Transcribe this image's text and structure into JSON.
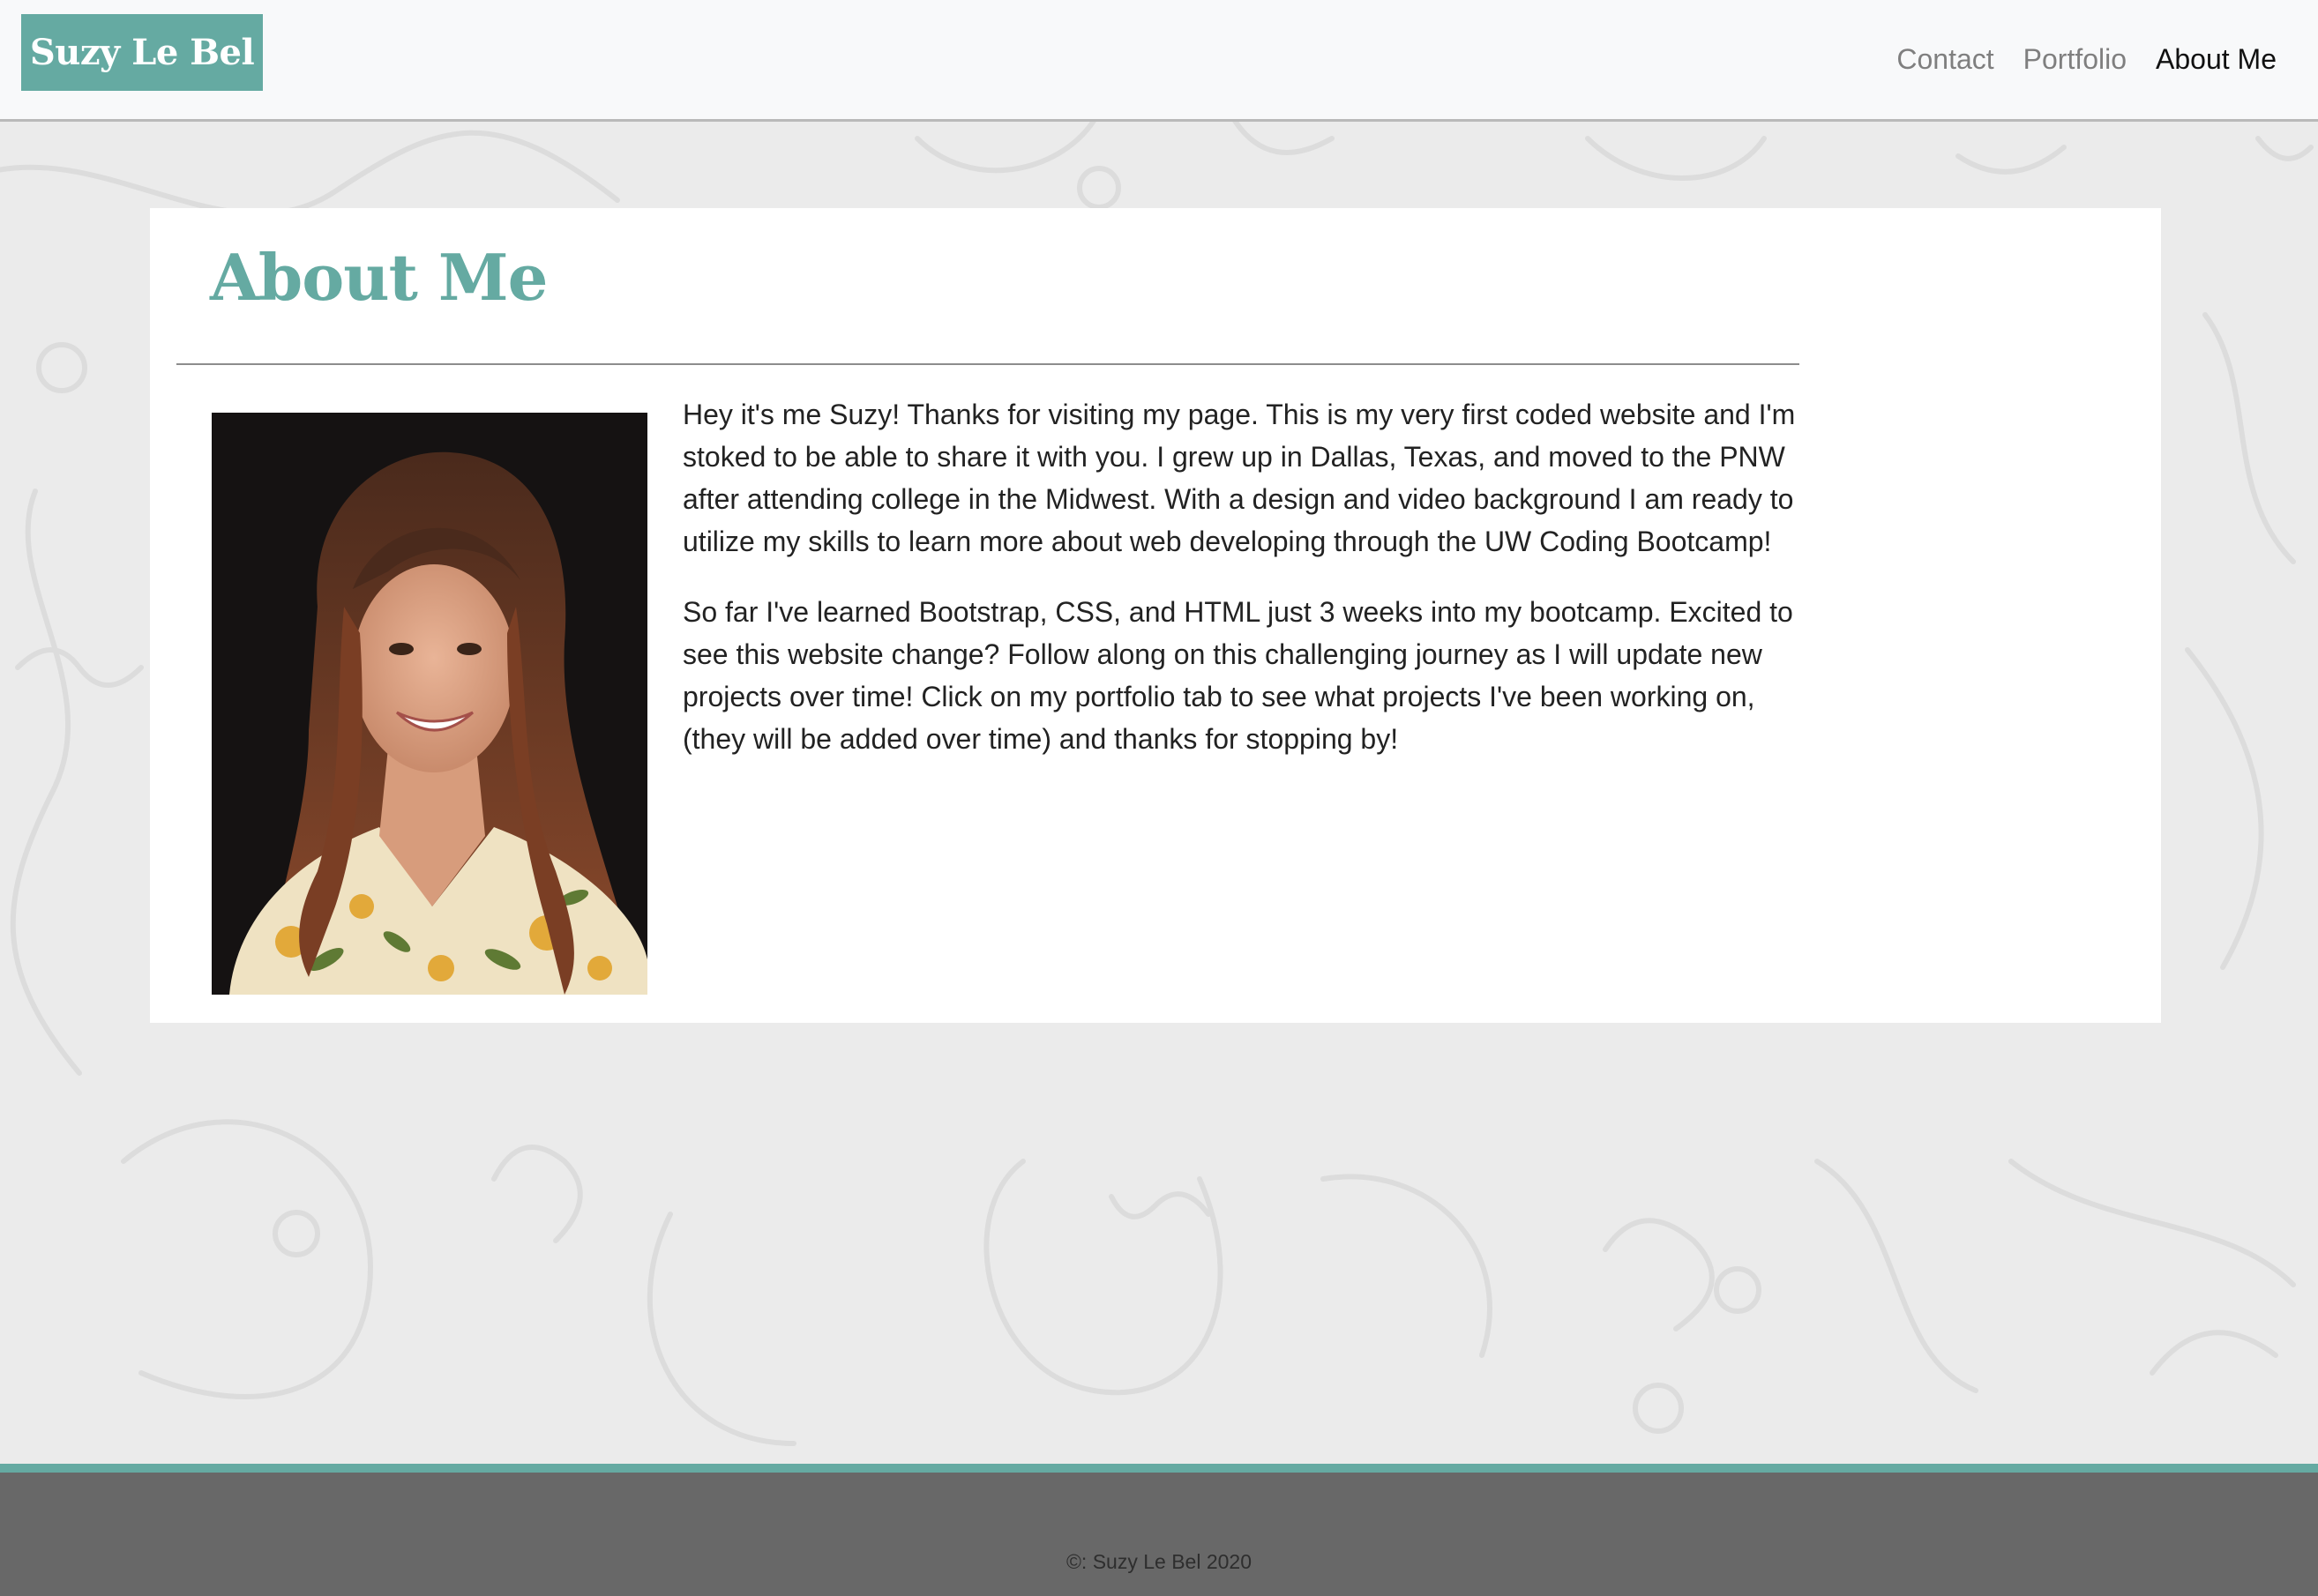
{
  "navbar": {
    "brand": "Suzy Le Bel",
    "links": [
      {
        "label": "Contact"
      },
      {
        "label": "Portfolio"
      },
      {
        "label": "About Me",
        "active": true
      }
    ]
  },
  "main": {
    "title": "About Me",
    "paragraphs": [
      "Hey it's me Suzy! Thanks for visiting my page. This is my very first coded website and I'm stoked to be able to share it with you. I grew up in Dallas, Texas, and moved to the PNW after attending college in the Midwest. With a design and video background I am ready to utilize my skills to learn more about web developing through the UW Coding Bootcamp!",
      "So far I've learned Bootstrap, CSS, and HTML just 3 weeks into my bootcamp. Excited to see this website change? Follow along on this challenging journey as I will update new projects over time! Click on my portfolio tab to see what projects I've been working on, (they will be added over time) and thanks for stopping by!"
    ]
  },
  "footer": {
    "text": "©: Suzy Le Bel 2020"
  },
  "colors": {
    "accent": "#65aaa2",
    "navbar_bg": "#f8f9fa",
    "page_bg": "#ebebeb",
    "footer_bg": "#686868"
  }
}
